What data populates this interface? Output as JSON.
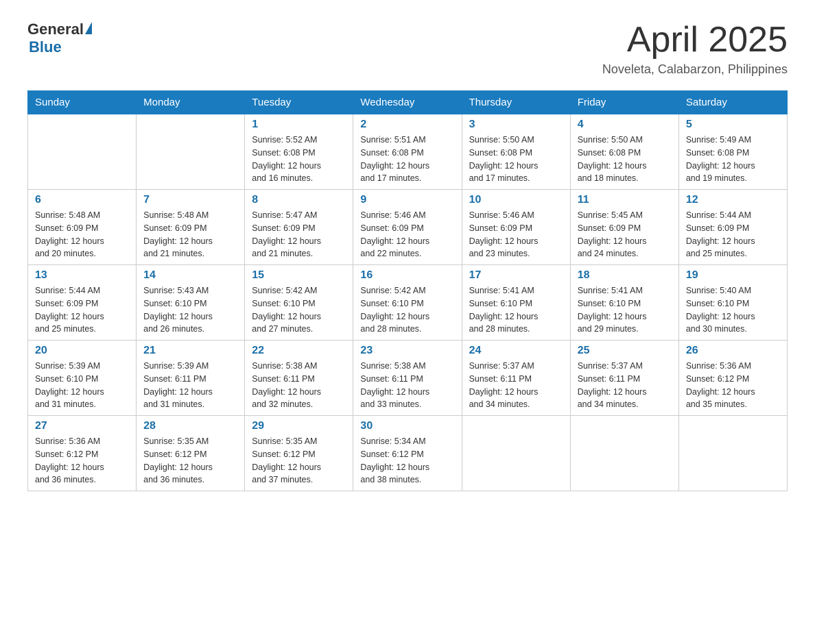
{
  "header": {
    "logo_general": "General",
    "logo_blue": "Blue",
    "month_title": "April 2025",
    "location": "Noveleta, Calabarzon, Philippines"
  },
  "days_of_week": [
    "Sunday",
    "Monday",
    "Tuesday",
    "Wednesday",
    "Thursday",
    "Friday",
    "Saturday"
  ],
  "weeks": [
    [
      {
        "day": "",
        "info": ""
      },
      {
        "day": "",
        "info": ""
      },
      {
        "day": "1",
        "info": "Sunrise: 5:52 AM\nSunset: 6:08 PM\nDaylight: 12 hours\nand 16 minutes."
      },
      {
        "day": "2",
        "info": "Sunrise: 5:51 AM\nSunset: 6:08 PM\nDaylight: 12 hours\nand 17 minutes."
      },
      {
        "day": "3",
        "info": "Sunrise: 5:50 AM\nSunset: 6:08 PM\nDaylight: 12 hours\nand 17 minutes."
      },
      {
        "day": "4",
        "info": "Sunrise: 5:50 AM\nSunset: 6:08 PM\nDaylight: 12 hours\nand 18 minutes."
      },
      {
        "day": "5",
        "info": "Sunrise: 5:49 AM\nSunset: 6:08 PM\nDaylight: 12 hours\nand 19 minutes."
      }
    ],
    [
      {
        "day": "6",
        "info": "Sunrise: 5:48 AM\nSunset: 6:09 PM\nDaylight: 12 hours\nand 20 minutes."
      },
      {
        "day": "7",
        "info": "Sunrise: 5:48 AM\nSunset: 6:09 PM\nDaylight: 12 hours\nand 21 minutes."
      },
      {
        "day": "8",
        "info": "Sunrise: 5:47 AM\nSunset: 6:09 PM\nDaylight: 12 hours\nand 21 minutes."
      },
      {
        "day": "9",
        "info": "Sunrise: 5:46 AM\nSunset: 6:09 PM\nDaylight: 12 hours\nand 22 minutes."
      },
      {
        "day": "10",
        "info": "Sunrise: 5:46 AM\nSunset: 6:09 PM\nDaylight: 12 hours\nand 23 minutes."
      },
      {
        "day": "11",
        "info": "Sunrise: 5:45 AM\nSunset: 6:09 PM\nDaylight: 12 hours\nand 24 minutes."
      },
      {
        "day": "12",
        "info": "Sunrise: 5:44 AM\nSunset: 6:09 PM\nDaylight: 12 hours\nand 25 minutes."
      }
    ],
    [
      {
        "day": "13",
        "info": "Sunrise: 5:44 AM\nSunset: 6:09 PM\nDaylight: 12 hours\nand 25 minutes."
      },
      {
        "day": "14",
        "info": "Sunrise: 5:43 AM\nSunset: 6:10 PM\nDaylight: 12 hours\nand 26 minutes."
      },
      {
        "day": "15",
        "info": "Sunrise: 5:42 AM\nSunset: 6:10 PM\nDaylight: 12 hours\nand 27 minutes."
      },
      {
        "day": "16",
        "info": "Sunrise: 5:42 AM\nSunset: 6:10 PM\nDaylight: 12 hours\nand 28 minutes."
      },
      {
        "day": "17",
        "info": "Sunrise: 5:41 AM\nSunset: 6:10 PM\nDaylight: 12 hours\nand 28 minutes."
      },
      {
        "day": "18",
        "info": "Sunrise: 5:41 AM\nSunset: 6:10 PM\nDaylight: 12 hours\nand 29 minutes."
      },
      {
        "day": "19",
        "info": "Sunrise: 5:40 AM\nSunset: 6:10 PM\nDaylight: 12 hours\nand 30 minutes."
      }
    ],
    [
      {
        "day": "20",
        "info": "Sunrise: 5:39 AM\nSunset: 6:10 PM\nDaylight: 12 hours\nand 31 minutes."
      },
      {
        "day": "21",
        "info": "Sunrise: 5:39 AM\nSunset: 6:11 PM\nDaylight: 12 hours\nand 31 minutes."
      },
      {
        "day": "22",
        "info": "Sunrise: 5:38 AM\nSunset: 6:11 PM\nDaylight: 12 hours\nand 32 minutes."
      },
      {
        "day": "23",
        "info": "Sunrise: 5:38 AM\nSunset: 6:11 PM\nDaylight: 12 hours\nand 33 minutes."
      },
      {
        "day": "24",
        "info": "Sunrise: 5:37 AM\nSunset: 6:11 PM\nDaylight: 12 hours\nand 34 minutes."
      },
      {
        "day": "25",
        "info": "Sunrise: 5:37 AM\nSunset: 6:11 PM\nDaylight: 12 hours\nand 34 minutes."
      },
      {
        "day": "26",
        "info": "Sunrise: 5:36 AM\nSunset: 6:12 PM\nDaylight: 12 hours\nand 35 minutes."
      }
    ],
    [
      {
        "day": "27",
        "info": "Sunrise: 5:36 AM\nSunset: 6:12 PM\nDaylight: 12 hours\nand 36 minutes."
      },
      {
        "day": "28",
        "info": "Sunrise: 5:35 AM\nSunset: 6:12 PM\nDaylight: 12 hours\nand 36 minutes."
      },
      {
        "day": "29",
        "info": "Sunrise: 5:35 AM\nSunset: 6:12 PM\nDaylight: 12 hours\nand 37 minutes."
      },
      {
        "day": "30",
        "info": "Sunrise: 5:34 AM\nSunset: 6:12 PM\nDaylight: 12 hours\nand 38 minutes."
      },
      {
        "day": "",
        "info": ""
      },
      {
        "day": "",
        "info": ""
      },
      {
        "day": "",
        "info": ""
      }
    ]
  ]
}
